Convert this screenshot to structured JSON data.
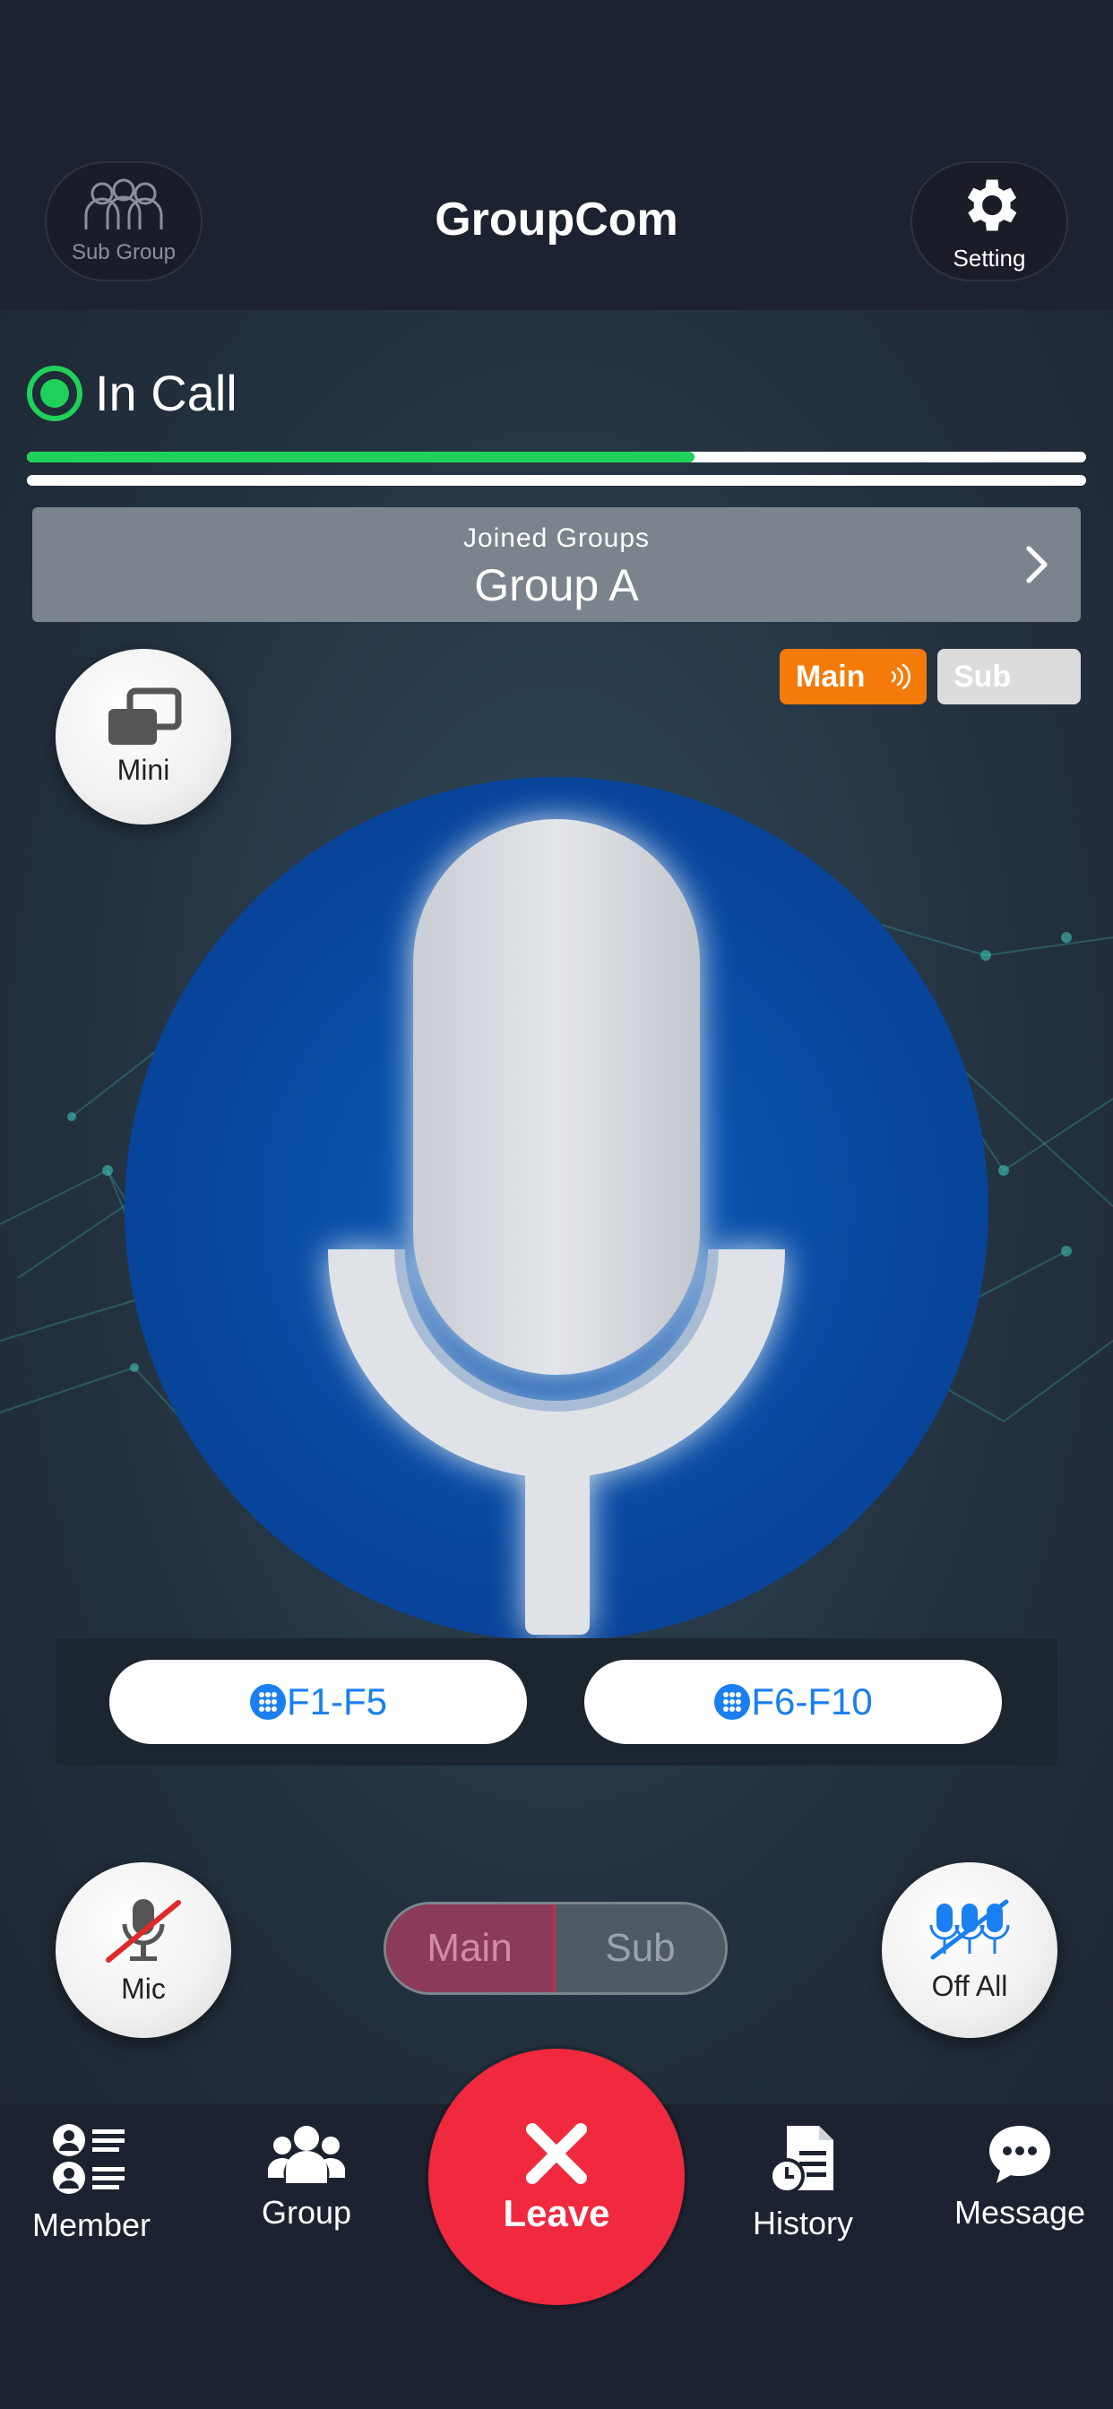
{
  "header": {
    "title": "GroupCom",
    "subgroup_label": "Sub Group",
    "setting_label": "Setting"
  },
  "status": {
    "label": "In Call",
    "progress_percent": 63,
    "status_color": "#1fd15a"
  },
  "joined_groups": {
    "caption": "Joined Groups",
    "group_name": "Group A"
  },
  "channel_chips": {
    "main_label": "Main",
    "sub_label": "Sub",
    "main_color": "#f47b0a"
  },
  "mini_button": {
    "label": "Mini"
  },
  "function_keys": {
    "left_label": "F1-F5",
    "right_label": "F6-F10"
  },
  "bottom_controls": {
    "mic_label": "Mic",
    "segment_main": "Main",
    "segment_sub": "Sub",
    "off_all_label": "Off All"
  },
  "tabbar": {
    "member": "Member",
    "group": "Group",
    "leave": "Leave",
    "history": "History",
    "message": "Message",
    "leave_color": "#f0293e"
  },
  "icons": [
    "people-outline-icon",
    "gear-icon",
    "chevron-right-icon",
    "sound-wave-icon",
    "window-stack-icon",
    "microphone-icon",
    "keypad-icon",
    "mic-off-icon",
    "mics-off-icon",
    "member-list-icon",
    "group-icon",
    "close-icon",
    "history-icon",
    "chat-bubble-icon"
  ]
}
